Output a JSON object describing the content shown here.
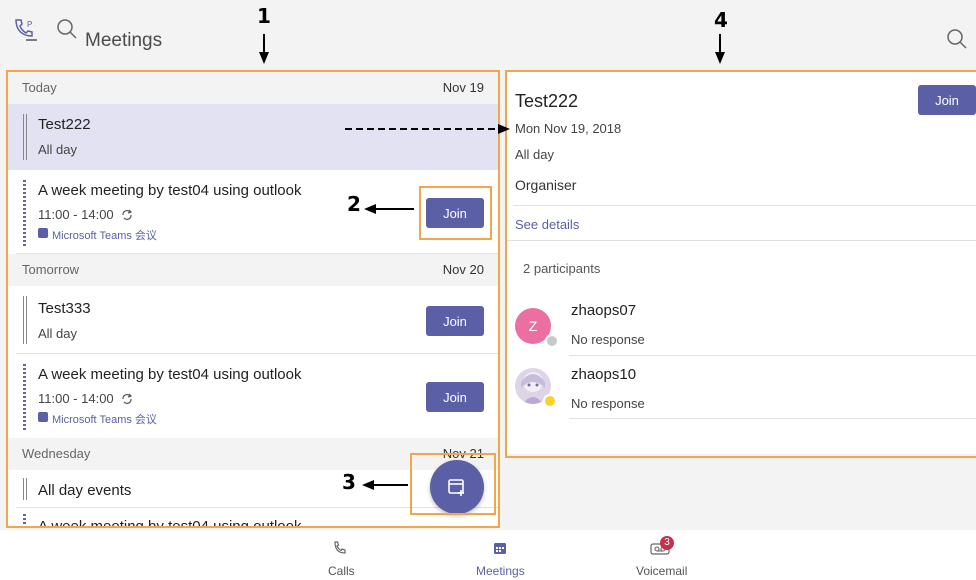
{
  "header": {
    "title": "Meetings"
  },
  "icons": {
    "calls_top": "phone-settings-icon",
    "search_left": "search-icon",
    "search_right": "search-icon"
  },
  "list": {
    "sections": [
      {
        "label": "Today",
        "date": "Nov 19"
      },
      {
        "label": "Tomorrow",
        "date": "Nov 20"
      },
      {
        "label": "Wednesday",
        "date": "Nov 21"
      }
    ],
    "meetings": [
      {
        "title": "Test222",
        "time": "All day"
      },
      {
        "title": "A week meeting by test04 using outlook",
        "time": "11:00 - 14:00",
        "platform": "Microsoft Teams 会议",
        "join": "Join"
      },
      {
        "title": "Test333",
        "time": "All day",
        "join": "Join"
      },
      {
        "title": "A week meeting by test04 using outlook",
        "time": "11:00 - 14:00",
        "platform": "Microsoft Teams 会议",
        "join": "Join"
      },
      {
        "title": "All day events"
      },
      {
        "title": "A week meeting by test04 using outlook"
      }
    ]
  },
  "details": {
    "title": "Test222",
    "join": "Join",
    "date": "Mon Nov 19, 2018",
    "time": "All day",
    "organiser_label": "Organiser",
    "see_details": "See details",
    "participants_count": "2 participants",
    "participants": [
      {
        "initial": "Z",
        "name": "zhaops07",
        "status": "No response",
        "avatar_color": "#ec6fa2"
      },
      {
        "name": "zhaops10",
        "status": "No response"
      }
    ]
  },
  "annotations": {
    "n1": "1",
    "n2": "2",
    "n3": "3",
    "n4": "4"
  },
  "bottom_nav": {
    "calls": "Calls",
    "meetings": "Meetings",
    "voicemail": "Voicemail",
    "voicemail_badge": "3"
  },
  "colors": {
    "accent": "#5b5fa5",
    "callout": "#f0a64a",
    "selected_row": "#e3e2f2",
    "badge": "#c4314b"
  }
}
